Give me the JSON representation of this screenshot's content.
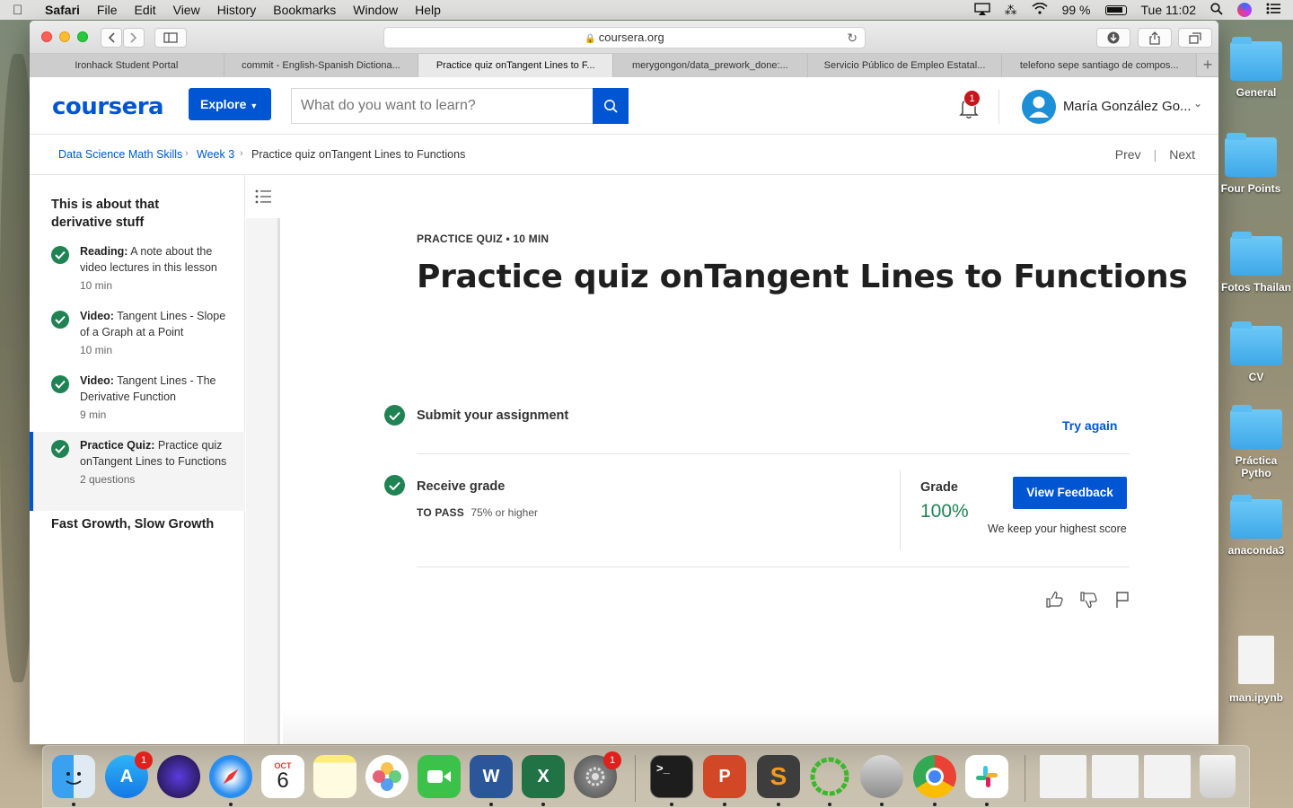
{
  "menubar": {
    "app": "Safari",
    "items": [
      "File",
      "Edit",
      "View",
      "History",
      "Bookmarks",
      "Window",
      "Help"
    ],
    "battery": "99 %",
    "clock": "Tue 11:02"
  },
  "browser": {
    "url": "coursera.org",
    "tabs": [
      "Ironhack Student Portal",
      "commit - English-Spanish Dictiona...",
      "Practice quiz onTangent Lines to F...",
      "merygongon/data_prework_done:...",
      "Servicio Público de Empleo Estatal...",
      "telefono sepe santiago de compos..."
    ],
    "active_tab": 2
  },
  "header": {
    "logo": "coursera",
    "explore_label": "Explore",
    "search_placeholder": "What do you want to learn?",
    "notification_count": "1",
    "user_name": "María González Go..."
  },
  "breadcrumb": {
    "course": "Data Science Math Skills",
    "week": "Week 3",
    "current": "Practice quiz onTangent Lines to Functions",
    "prev": "Prev",
    "next": "Next"
  },
  "sidebar": {
    "section_title": "This is about that derivative stuff",
    "items": [
      {
        "type": "Reading:",
        "title": "A note about the video lectures in this lesson",
        "meta": "10 min"
      },
      {
        "type": "Video:",
        "title": "Tangent Lines - Slope of a Graph at a Point",
        "meta": "10 min"
      },
      {
        "type": "Video:",
        "title": "Tangent Lines - The Derivative Function",
        "meta": "9 min"
      },
      {
        "type": "Practice Quiz:",
        "title": "Practice quiz onTangent Lines to Functions",
        "meta": "2 questions"
      }
    ],
    "next_section": "Fast Growth, Slow Growth"
  },
  "main": {
    "eyebrow": "PRACTICE QUIZ • 10 MIN",
    "title": "Practice quiz onTangent Lines to Functions",
    "submit_title": "Submit your assignment",
    "try_again": "Try again",
    "receive_title": "Receive grade",
    "to_pass_label": "TO PASS",
    "to_pass_value": "75% or higher",
    "grade_label": "Grade",
    "grade_value": "100%",
    "view_feedback": "View Feedback",
    "keep_note": "We keep your highest score"
  },
  "desktop": {
    "items": [
      "General",
      "Four Points",
      "Fotos Thailan",
      "CV",
      "Práctica Pytho",
      "anaconda3",
      "man.ipynb"
    ]
  },
  "dock": {
    "apps": [
      "Finder",
      "App Store",
      "Siri",
      "Safari",
      "Calendar",
      "Notes",
      "Photos",
      "FaceTime",
      "Word",
      "Excel",
      "System Preferences",
      "Terminal",
      "PowerPoint",
      "Sublime Text",
      "Anaconda",
      "Disk Utility",
      "Chrome",
      "Slack",
      "Trash"
    ],
    "calendar_month": "OCT",
    "calendar_day": "6",
    "appstore_badge": "1",
    "prefs_badge": "1"
  },
  "colors": {
    "brand": "#0056d2",
    "success": "#1f8354",
    "notification": "#c4161c"
  }
}
